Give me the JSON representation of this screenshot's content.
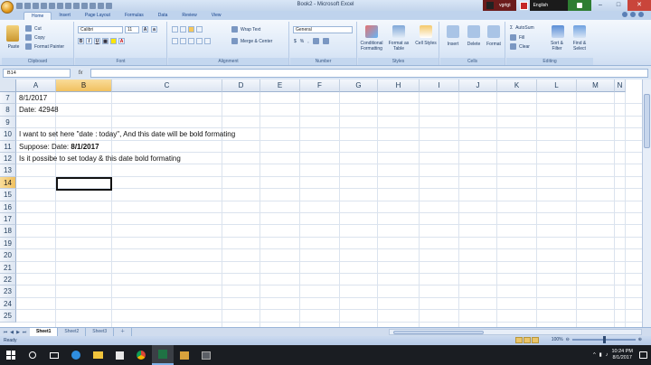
{
  "window": {
    "title": "Book2 - Microsoft Excel",
    "tray_app": "vgrtgt",
    "language": "English"
  },
  "ribbon": {
    "tabs": [
      "Home",
      "Insert",
      "Page Layout",
      "Formulas",
      "Data",
      "Review",
      "View"
    ],
    "active_tab": "Home",
    "clipboard": {
      "paste": "Paste",
      "cut": "Cut",
      "copy": "Copy",
      "format_painter": "Format Painter",
      "label": "Clipboard"
    },
    "font": {
      "name": "Calibri",
      "size": "11",
      "bold": "B",
      "italic": "I",
      "underline": "U",
      "label": "Font"
    },
    "alignment": {
      "wrap_text": "Wrap Text",
      "merge_center": "Merge & Center",
      "label": "Alignment"
    },
    "number": {
      "format": "General",
      "currency": "$",
      "percent": "%",
      "comma": ",",
      "label": "Number"
    },
    "styles": {
      "conditional": "Conditional Formatting",
      "format_table": "Format as Table",
      "cell_styles": "Cell Styles",
      "label": "Styles"
    },
    "cells": {
      "insert": "Insert",
      "delete": "Delete",
      "format": "Format",
      "label": "Cells"
    },
    "editing": {
      "autosum": "AutoSum",
      "fill": "Fill",
      "clear": "Clear",
      "sort_filter": "Sort & Filter",
      "find_select": "Find & Select",
      "label": "Editing"
    }
  },
  "formula_bar": {
    "name_box": "B14",
    "fx": "fx",
    "content": ""
  },
  "grid": {
    "columns": [
      "A",
      "B",
      "C",
      "D",
      "E",
      "F",
      "G",
      "H",
      "I",
      "J",
      "K",
      "L",
      "M",
      "N"
    ],
    "selected_column": "B",
    "rows": [
      "7",
      "8",
      "9",
      "10",
      "11",
      "12",
      "13",
      "14",
      "15",
      "16",
      "17",
      "18",
      "19",
      "20",
      "21",
      "22",
      "23",
      "24",
      "25"
    ],
    "selected_row": "14",
    "cells": {
      "r7": "8/1/2017",
      "r8": "Date: 42948",
      "r10": "I want to set here \"date : today\", And this date will be bold formating",
      "r11_prefix": "Suppose: Date: ",
      "r11_bold": "8/1/2017",
      "r12": "Is it possibe to set today & this date bold formating"
    }
  },
  "sheets": [
    "Sheet1",
    "Sheet2",
    "Sheet3"
  ],
  "active_sheet": "Sheet1",
  "status": {
    "mode": "Ready",
    "zoom": "100%"
  },
  "taskbar": {
    "time": "10:24 PM",
    "date": "8/1/2017"
  }
}
